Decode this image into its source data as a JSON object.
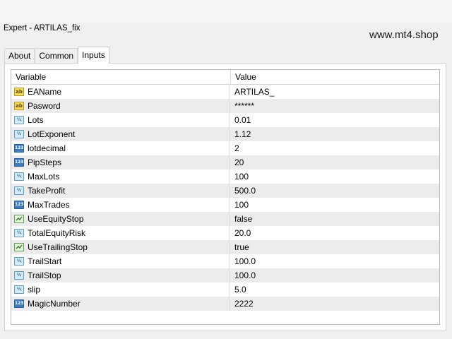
{
  "window": {
    "title": "Expert - ARTILAS_fix"
  },
  "watermark": "www.mt4.shop",
  "tabs": [
    {
      "label": "About",
      "active": false
    },
    {
      "label": "Common",
      "active": false
    },
    {
      "label": "Inputs",
      "active": true
    }
  ],
  "table": {
    "headers": {
      "variable": "Variable",
      "value": "Value"
    },
    "rows": [
      {
        "name": "EAName",
        "value": "ARTILAS_",
        "icon": "string-type-icon"
      },
      {
        "name": "Pasword",
        "value": "******",
        "icon": "string-type-icon"
      },
      {
        "name": "Lots",
        "value": "0.01",
        "icon": "double-type-icon"
      },
      {
        "name": "LotExponent",
        "value": "1.12",
        "icon": "double-type-icon"
      },
      {
        "name": "lotdecimal",
        "value": "2",
        "icon": "integer-type-icon"
      },
      {
        "name": "PipSteps",
        "value": "20",
        "icon": "integer-type-icon"
      },
      {
        "name": "MaxLots",
        "value": "100",
        "icon": "double-type-icon"
      },
      {
        "name": "TakeProfit",
        "value": "500.0",
        "icon": "double-type-icon"
      },
      {
        "name": "MaxTrades",
        "value": "100",
        "icon": "integer-type-icon"
      },
      {
        "name": "UseEquityStop",
        "value": "false",
        "icon": "boolean-type-icon"
      },
      {
        "name": "TotalEquityRisk",
        "value": "20.0",
        "icon": "double-type-icon"
      },
      {
        "name": "UseTrailingStop",
        "value": "true",
        "icon": "boolean-type-icon"
      },
      {
        "name": "TrailStart",
        "value": "100.0",
        "icon": "double-type-icon"
      },
      {
        "name": "TrailStop",
        "value": "100.0",
        "icon": "double-type-icon"
      },
      {
        "name": "slip",
        "value": "5.0",
        "icon": "double-type-icon"
      },
      {
        "name": "MagicNumber",
        "value": "2222",
        "icon": "integer-type-icon"
      }
    ]
  }
}
